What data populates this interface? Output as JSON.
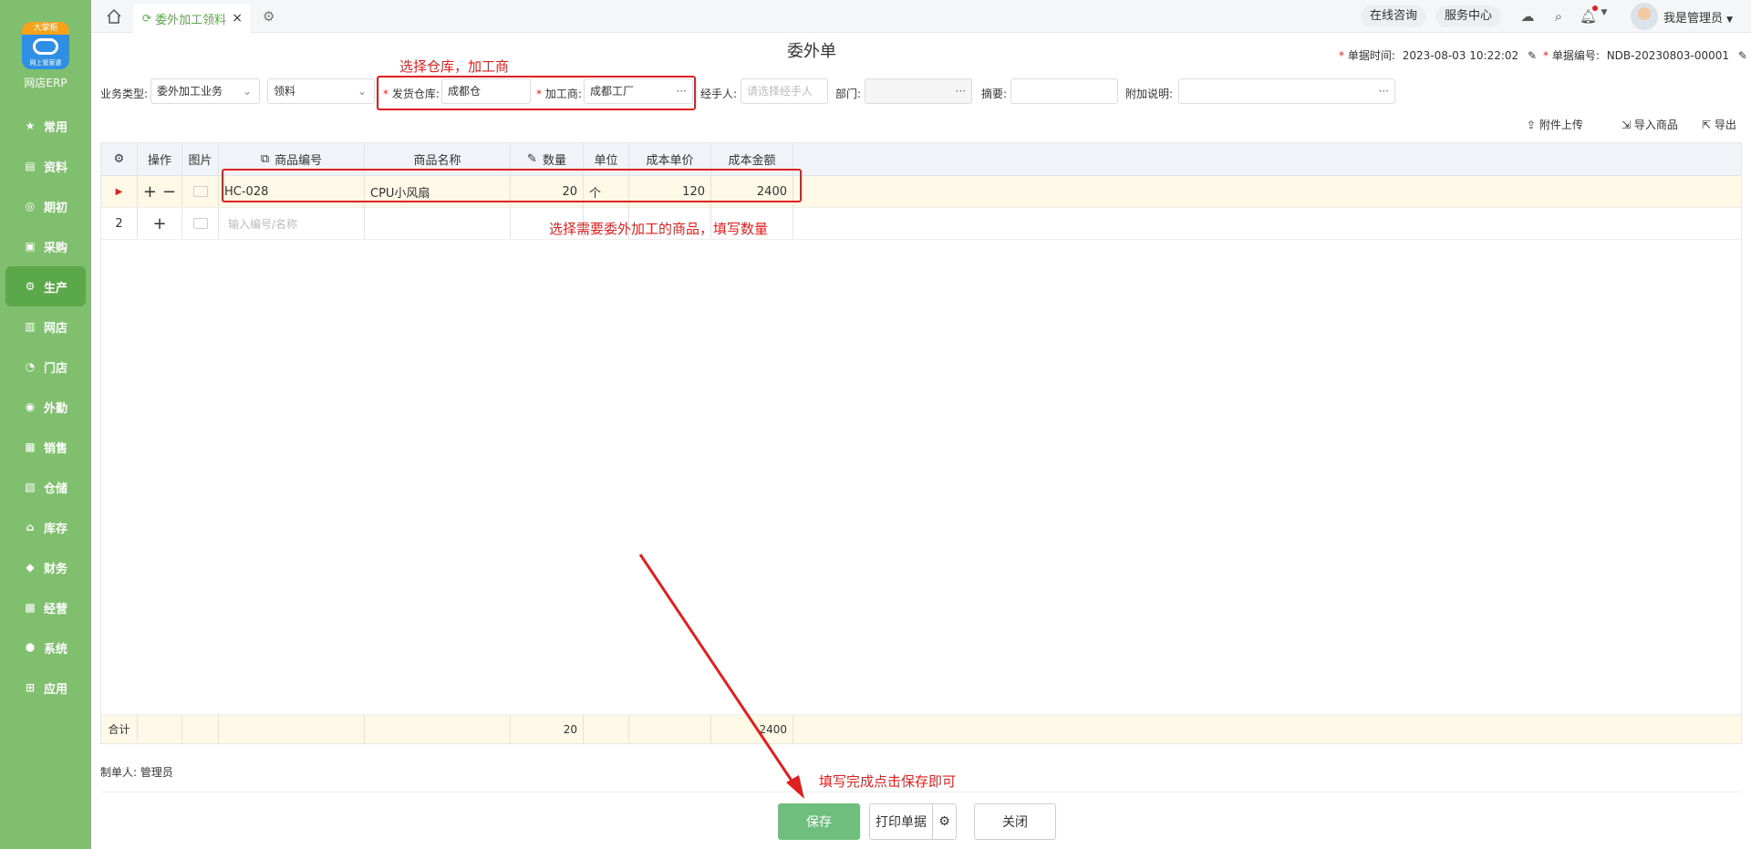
{
  "sidebar": {
    "logo_band": "大掌柜",
    "logo_caption": "网上管家婆",
    "brand": "网店ERP",
    "items": [
      {
        "label": "常用",
        "icon": "star-icon"
      },
      {
        "label": "资料",
        "icon": "document-icon"
      },
      {
        "label": "期初",
        "icon": "cycle-icon"
      },
      {
        "label": "采购",
        "icon": "purchase-icon"
      },
      {
        "label": "生产",
        "icon": "production-icon"
      },
      {
        "label": "网店",
        "icon": "shop-icon"
      },
      {
        "label": "门店",
        "icon": "store-icon"
      },
      {
        "label": "外勤",
        "icon": "field-icon"
      },
      {
        "label": "销售",
        "icon": "sales-icon"
      },
      {
        "label": "仓储",
        "icon": "warehouse-icon"
      },
      {
        "label": "库存",
        "icon": "inventory-icon"
      },
      {
        "label": "财务",
        "icon": "finance-icon"
      },
      {
        "label": "经营",
        "icon": "business-icon"
      },
      {
        "label": "系统",
        "icon": "system-icon"
      },
      {
        "label": "应用",
        "icon": "apps-icon"
      }
    ]
  },
  "topbar": {
    "tab_label": "委外加工领料",
    "tab_close": "×",
    "consult": "在线咨询",
    "service": "服务中心",
    "user": "我是管理员"
  },
  "form": {
    "title": "委外单",
    "date_label": "单据时间:",
    "date_value": "2023-08-03 10:22:02",
    "no_label": "单据编号:",
    "no_value": "NDB-20230803-00001",
    "biz_type_label": "业务类型:",
    "biz_type_value": "委外加工业务",
    "sub_type_value": "领料",
    "warehouse_label": "发货仓库:",
    "warehouse_value": "成都仓",
    "processor_label": "加工商:",
    "processor_value": "成都工厂",
    "handler_label": "经手人:",
    "handler_placeholder": "请选择经手人",
    "dept_label": "部门:",
    "summary_label": "摘要:",
    "note_label": "附加说明:",
    "required_mark": "*",
    "dots": "···"
  },
  "toolbar": {
    "upload": "附件上传",
    "import": "导入商品",
    "export": "导出"
  },
  "grid": {
    "headers": {
      "ops": "操作",
      "img": "图片",
      "code": "商品编号",
      "name": "商品名称",
      "qty": "数量",
      "unit": "单位",
      "price": "成本单价",
      "amount": "成本金额"
    },
    "row1": {
      "code": "HC-028",
      "name": "CPU小风扇",
      "qty": "20",
      "unit": "个",
      "price": "120",
      "amount": "2400"
    },
    "row2": {
      "index": "2",
      "placeholder": "输入编号/名称"
    },
    "total": {
      "label": "合计",
      "qty": "20",
      "amount": "2400"
    }
  },
  "footer": {
    "maker_label": "制单人:",
    "maker_value": "管理员",
    "save": "保存",
    "print": "打印单据",
    "close": "关闭"
  },
  "annotations": {
    "warehouse_note": "选择仓库，加工商",
    "goods_note": "选择需要委外加工的商品，填写数量",
    "save_note": "填写完成点击保存即可"
  },
  "colors": {
    "sidebar": "#7fbf6e",
    "accent": "#5aa849",
    "annotation": "#e02020",
    "save_button": "#6fbe7e"
  }
}
